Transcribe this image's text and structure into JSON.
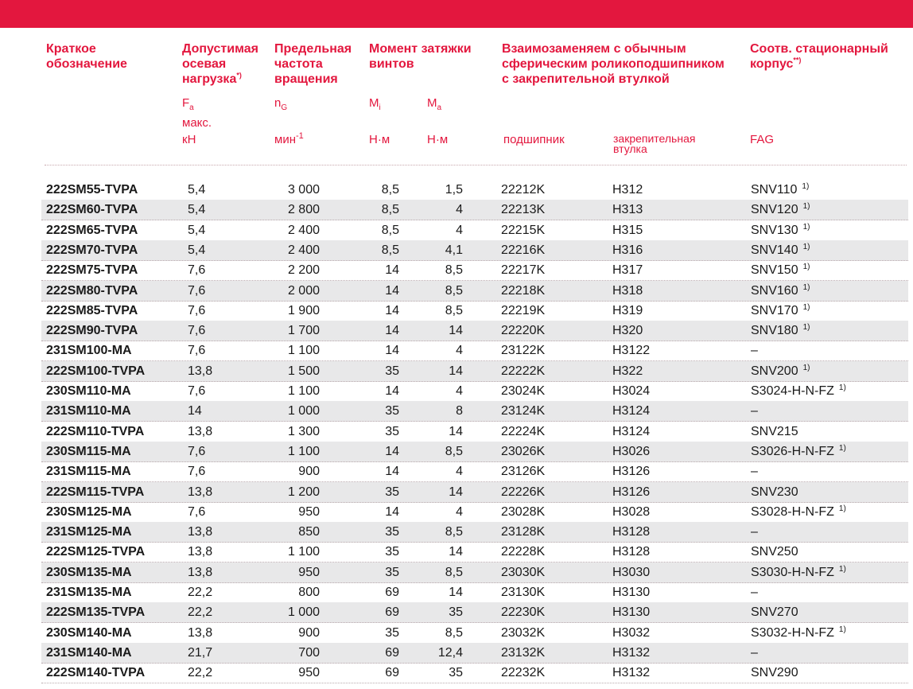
{
  "header": {
    "designation": [
      "Краткое",
      "обозначение"
    ],
    "axial_load": [
      "Допустимая",
      "осевая",
      "нагрузка"
    ],
    "axial_load_note": "*)",
    "axial_load_symbol": "F",
    "axial_load_symbol_sub": "a",
    "axial_load_max": "макс.",
    "axial_load_unit": "кН",
    "speed": [
      "Предельная",
      "частота",
      "вращения"
    ],
    "speed_symbol": "n",
    "speed_symbol_sub": "G",
    "speed_unit": "мин",
    "speed_unit_exp": "-1",
    "torque": [
      "Момент затяжки",
      "винтов"
    ],
    "torque_mi": "M",
    "torque_mi_sub": "i",
    "torque_ma": "M",
    "torque_ma_sub": "a",
    "torque_unit_mi": "Н·м",
    "torque_unit_ma": "Н·м",
    "interchange": [
      "Взаимозаменяем с обычным",
      "сферическим роликоподшипником",
      "с закрепительной втулкой"
    ],
    "bearing_label": "подшипник",
    "sleeve_label": [
      "закрепительная",
      "втулка"
    ],
    "housing": [
      "Соотв. стационарный",
      "корпус"
    ],
    "housing_note": "**)",
    "housing_brand": "FAG"
  },
  "rows": [
    {
      "designation": "222SM55-TVPA",
      "fa": "5,4",
      "ng": "3 000",
      "mi": "8,5",
      "ma": "1,5",
      "bearing": "22212K",
      "sleeve": "H312",
      "housing": "SNV110",
      "note": "1)"
    },
    {
      "designation": "222SM60-TVPA",
      "fa": "5,4",
      "ng": "2 800",
      "mi": "8,5",
      "ma": "4",
      "bearing": "22213K",
      "sleeve": "H313",
      "housing": "SNV120",
      "note": "1)"
    },
    {
      "designation": "222SM65-TVPA",
      "fa": "5,4",
      "ng": "2 400",
      "mi": "8,5",
      "ma": "4",
      "bearing": "22215K",
      "sleeve": "H315",
      "housing": "SNV130",
      "note": "1)"
    },
    {
      "designation": "222SM70-TVPA",
      "fa": "5,4",
      "ng": "2 400",
      "mi": "8,5",
      "ma": "4,1",
      "bearing": "22216K",
      "sleeve": "H316",
      "housing": "SNV140",
      "note": "1)"
    },
    {
      "designation": "222SM75-TVPA",
      "fa": "7,6",
      "ng": "2 200",
      "mi": "14",
      "ma": "8,5",
      "bearing": "22217K",
      "sleeve": "H317",
      "housing": "SNV150",
      "note": "1)"
    },
    {
      "designation": "222SM80-TVPA",
      "fa": "7,6",
      "ng": "2 000",
      "mi": "14",
      "ma": "8,5",
      "bearing": "22218K",
      "sleeve": "H318",
      "housing": "SNV160",
      "note": "1)"
    },
    {
      "designation": "222SM85-TVPA",
      "fa": "7,6",
      "ng": "1 900",
      "mi": "14",
      "ma": "8,5",
      "bearing": "22219K",
      "sleeve": "H319",
      "housing": "SNV170",
      "note": "1)"
    },
    {
      "designation": "222SM90-TVPA",
      "fa": "7,6",
      "ng": "1 700",
      "mi": "14",
      "ma": "14",
      "bearing": "22220K",
      "sleeve": "H320",
      "housing": "SNV180",
      "note": "1)"
    },
    {
      "designation": "231SM100-MA",
      "fa": "7,6",
      "ng": "1 100",
      "mi": "14",
      "ma": "4",
      "bearing": "23122K",
      "sleeve": "H3122",
      "housing": "–",
      "note": ""
    },
    {
      "designation": "222SM100-TVPA",
      "fa": "13,8",
      "ng": "1 500",
      "mi": "35",
      "ma": "14",
      "bearing": "22222K",
      "sleeve": "H322",
      "housing": "SNV200",
      "note": "1)"
    },
    {
      "designation": "230SM110-MA",
      "fa": "7,6",
      "ng": "1 100",
      "mi": "14",
      "ma": "4",
      "bearing": "23024K",
      "sleeve": "H3024",
      "housing": "S3024-H-N-FZ",
      "note": "1)"
    },
    {
      "designation": "231SM110-MA",
      "fa": "14",
      "ng": "1 000",
      "mi": "35",
      "ma": "8",
      "bearing": "23124K",
      "sleeve": "H3124",
      "housing": "–",
      "note": ""
    },
    {
      "designation": "222SM110-TVPA",
      "fa": "13,8",
      "ng": "1 300",
      "mi": "35",
      "ma": "14",
      "bearing": "22224K",
      "sleeve": "H3124",
      "housing": "SNV215",
      "note": ""
    },
    {
      "designation": "230SM115-MA",
      "fa": "7,6",
      "ng": "1 100",
      "mi": "14",
      "ma": "8,5",
      "bearing": "23026K",
      "sleeve": "H3026",
      "housing": "S3026-H-N-FZ",
      "note": "1)"
    },
    {
      "designation": "231SM115-MA",
      "fa": "7,6",
      "ng": "900",
      "mi": "14",
      "ma": "4",
      "bearing": "23126K",
      "sleeve": "H3126",
      "housing": "–",
      "note": ""
    },
    {
      "designation": "222SM115-TVPA",
      "fa": "13,8",
      "ng": "1 200",
      "mi": "35",
      "ma": "14",
      "bearing": "22226K",
      "sleeve": "H3126",
      "housing": "SNV230",
      "note": ""
    },
    {
      "designation": "230SM125-MA",
      "fa": "7,6",
      "ng": "950",
      "mi": "14",
      "ma": "4",
      "bearing": "23028K",
      "sleeve": "H3028",
      "housing": "S3028-H-N-FZ",
      "note": "1)"
    },
    {
      "designation": "231SM125-MA",
      "fa": "13,8",
      "ng": "850",
      "mi": "35",
      "ma": "8,5",
      "bearing": "23128K",
      "sleeve": "H3128",
      "housing": "–",
      "note": ""
    },
    {
      "designation": "222SM125-TVPA",
      "fa": "13,8",
      "ng": "1 100",
      "mi": "35",
      "ma": "14",
      "bearing": "22228K",
      "sleeve": "H3128",
      "housing": "SNV250",
      "note": ""
    },
    {
      "designation": "230SM135-MA",
      "fa": "13,8",
      "ng": "950",
      "mi": "35",
      "ma": "8,5",
      "bearing": "23030K",
      "sleeve": "H3030",
      "housing": "S3030-H-N-FZ",
      "note": "1)"
    },
    {
      "designation": "231SM135-MA",
      "fa": "22,2",
      "ng": "800",
      "mi": "69",
      "ma": "14",
      "bearing": "23130K",
      "sleeve": "H3130",
      "housing": "–",
      "note": ""
    },
    {
      "designation": "222SM135-TVPA",
      "fa": "22,2",
      "ng": "1 000",
      "mi": "69",
      "ma": "35",
      "bearing": "22230K",
      "sleeve": "H3130",
      "housing": "SNV270",
      "note": ""
    },
    {
      "designation": "230SM140-MA",
      "fa": "13,8",
      "ng": "900",
      "mi": "35",
      "ma": "8,5",
      "bearing": "23032K",
      "sleeve": "H3032",
      "housing": "S3032-H-N-FZ",
      "note": "1)"
    },
    {
      "designation": "231SM140-MA",
      "fa": "21,7",
      "ng": "700",
      "mi": "69",
      "ma": "12,4",
      "bearing": "23132K",
      "sleeve": "H3132",
      "housing": "–",
      "note": ""
    },
    {
      "designation": "222SM140-TVPA",
      "fa": "22,2",
      "ng": "950",
      "mi": "69",
      "ma": "35",
      "bearing": "22232K",
      "sleeve": "H3132",
      "housing": "SNV290",
      "note": ""
    }
  ],
  "colors": {
    "accent": "#e3173e",
    "row_shade": "#e8e8e9",
    "text": "#1a1a1a"
  }
}
